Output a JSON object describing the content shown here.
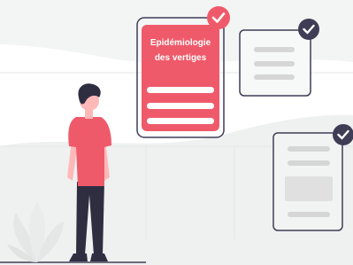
{
  "illustration": {
    "primary_card": {
      "title_line1": "Epidémiologie",
      "title_line2": "des vertiges",
      "checked": true
    },
    "secondary_cards": [
      {
        "checked": true
      },
      {
        "checked": true
      }
    ]
  },
  "colors": {
    "accent": "#EF5A6A",
    "outline": "#3F3D56",
    "placeholder": "#D6D6D6",
    "background": "#EEF1F0",
    "figure_hair": "#2F2E41",
    "figure_pants": "#2F2E41",
    "figure_skin": "#FFB8B8"
  },
  "icons": [
    "check-icon",
    "plant-illustration",
    "person-illustration"
  ]
}
